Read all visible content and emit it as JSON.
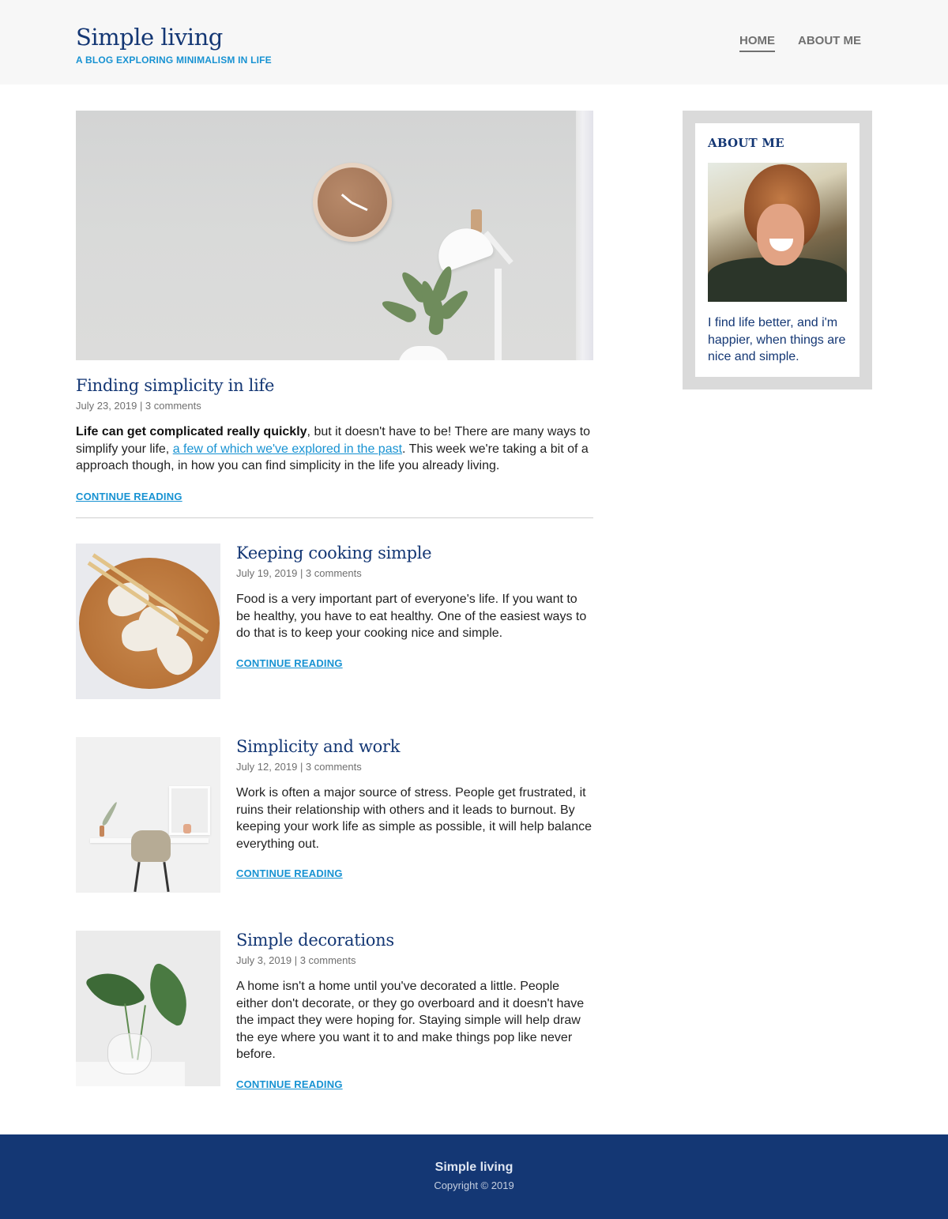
{
  "site": {
    "title": "Simple living",
    "subtitle": "A BLOG EXPLORING MINIMALISM IN LIFE"
  },
  "nav": {
    "items": [
      {
        "label": "HOME",
        "active": true
      },
      {
        "label": "ABOUT ME",
        "active": false
      }
    ]
  },
  "featured": {
    "image_icon": "clock-lamp-plant-photo",
    "title": "Finding simplicity in life",
    "meta": "July 23, 2019 | 3 comments",
    "excerpt_bold": "Life can get complicated really quickly",
    "excerpt_part1": ", but it doesn't have to be! There are many ways to simplify your life, ",
    "excerpt_link": "a few of which we've explored in the past",
    "excerpt_part2": ". This week we're taking a bit of a approach though, in how you can find simplicity in the life you already living.",
    "continue_label": "CONTINUE READING"
  },
  "posts": [
    {
      "image_icon": "dumplings-plate-photo",
      "title": "Keeping cooking simple",
      "meta": "July 19, 2019 | 3 comments",
      "excerpt": "Food is a very important part of everyone's life. If you want to be healthy, you have to eat healthy. One of the easiest ways to do that is to keep your cooking nice and simple.",
      "continue_label": "CONTINUE READING"
    },
    {
      "image_icon": "desk-chair-photo",
      "title": "Simplicity and work",
      "meta": "July 12, 2019 | 3 comments",
      "excerpt": "Work is often a major source of stress. People get frustrated, it ruins their relationship with others and it leads to burnout. By keeping your work life as simple as possible, it will help balance everything out.",
      "continue_label": "CONTINUE READING"
    },
    {
      "image_icon": "plant-vase-photo",
      "title": "Simple decorations",
      "meta": "July 3, 2019 | 3 comments",
      "excerpt": "A home isn't a home until you've decorated a little. People either don't decorate, or they go overboard and it doesn't have the impact they were hoping for. Staying simple will help draw the eye where you want it to and make things pop like never before.",
      "continue_label": "CONTINUE READING"
    }
  ],
  "sidebar": {
    "widget_title": "ABOUT ME",
    "avatar_icon": "smiling-man-avatar",
    "text": "I find life better, and i'm happier, when things are nice and simple."
  },
  "footer": {
    "title": "Simple living",
    "copyright": "Copyright © 2019"
  },
  "colors": {
    "brand_dark": "#143774",
    "accent": "#1792d2",
    "header_bg": "#f7f7f7",
    "sidebar_bg": "#dadada"
  }
}
